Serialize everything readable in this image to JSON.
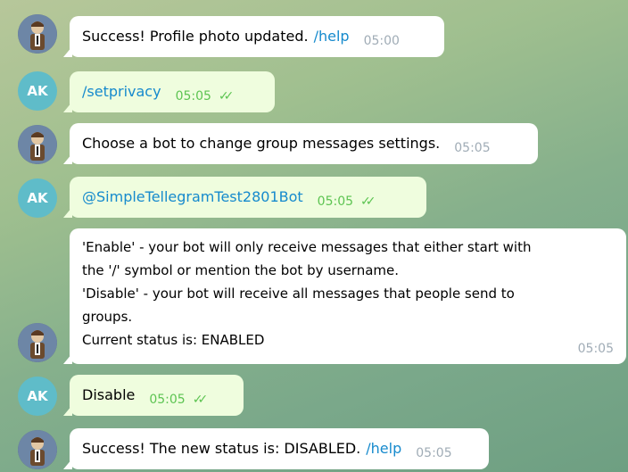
{
  "messages": [
    {
      "side": "in",
      "text": "Success! Profile photo updated.",
      "link": "/help",
      "time": "05:00"
    },
    {
      "side": "out",
      "avatar": "AK",
      "link": "/setprivacy",
      "time": "05:05",
      "ticks": "✓✓"
    },
    {
      "side": "in",
      "text": "Choose a bot to change group messages settings.",
      "time": "05:05"
    },
    {
      "side": "out",
      "avatar": "AK",
      "link": "@SimpleTellegramTest2801Bot",
      "time": "05:05",
      "ticks": "✓✓"
    },
    {
      "side": "in",
      "lines": [
        "'Enable' - your bot will only receive messages that either start with",
        "the '/' symbol or mention the bot by username.",
        "'Disable' - your bot will receive all messages that people send to",
        "groups.",
        "Current status is: ENABLED"
      ],
      "time": "05:05"
    },
    {
      "side": "out",
      "avatar": "AK",
      "text": "Disable",
      "time": "05:05",
      "ticks": "✓✓"
    },
    {
      "side": "in",
      "text": "Success! The new status is: DISABLED.",
      "link": "/help",
      "time": "05:05"
    }
  ],
  "colors": {
    "incoming_bubble": "#ffffff",
    "outgoing_bubble": "#effdde",
    "link": "#168acd",
    "outgoing_time": "#5dc452",
    "incoming_time": "#a0acb6",
    "user_avatar": "#5fbcc9"
  },
  "icons": {
    "bot_avatar": "bot-avatar-icon",
    "read_ticks": "double-check-icon"
  }
}
